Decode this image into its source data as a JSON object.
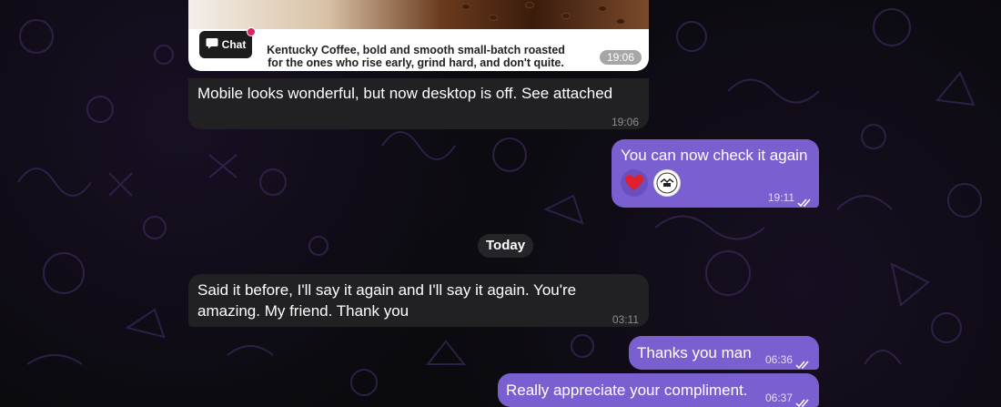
{
  "image_message": {
    "chat_button_label": "Chat",
    "promo_line1": "Kentucky Coffee, bold and smooth small-batch roasted",
    "promo_line2": "for the ones who rise early, grind hard, and don't quite.",
    "time": "19:06"
  },
  "messages": [
    {
      "text": "Mobile looks wonderful, but now desktop is off. See attached",
      "time": "19:06"
    },
    {
      "text": "You can now check it again",
      "time": "19:11"
    },
    {
      "date": "Today"
    },
    {
      "text_line1": "Said it before, I'll say it again and I'll say it again. You're",
      "text_line2": "amazing. My friend. Thank you",
      "time": "03:11"
    },
    {
      "text": "Thanks you man",
      "time": "06:36"
    },
    {
      "text": "Really appreciate your compliment.",
      "time": "06:37"
    }
  ],
  "reactions": [
    "red-heart",
    "avatar"
  ],
  "colors": {
    "incoming": "#212124",
    "outgoing": "#7a5fd0",
    "background": "#0a0a0d"
  }
}
